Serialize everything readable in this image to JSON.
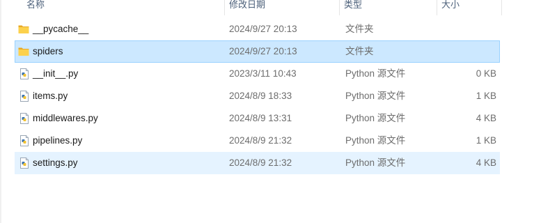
{
  "columns": {
    "name": "名称",
    "date": "修改日期",
    "type": "类型",
    "size": "大小"
  },
  "files": [
    {
      "name": "__pycache__",
      "date": "2024/9/27 20:13",
      "type": "文件夹",
      "size": "",
      "icon": "folder-icon",
      "state": "normal"
    },
    {
      "name": "spiders",
      "date": "2024/9/27 20:13",
      "type": "文件夹",
      "size": "",
      "icon": "folder-icon",
      "state": "selected"
    },
    {
      "name": "__init__.py",
      "date": "2023/3/11 10:43",
      "type": "Python 源文件",
      "size": "0 KB",
      "icon": "python-file-icon",
      "state": "normal"
    },
    {
      "name": "items.py",
      "date": "2024/8/9 18:33",
      "type": "Python 源文件",
      "size": "1 KB",
      "icon": "python-file-icon",
      "state": "normal"
    },
    {
      "name": "middlewares.py",
      "date": "2024/8/9 13:31",
      "type": "Python 源文件",
      "size": "4 KB",
      "icon": "python-file-icon",
      "state": "normal"
    },
    {
      "name": "pipelines.py",
      "date": "2024/8/9 21:32",
      "type": "Python 源文件",
      "size": "1 KB",
      "icon": "python-file-icon",
      "state": "normal"
    },
    {
      "name": "settings.py",
      "date": "2024/8/9 21:32",
      "type": "Python 源文件",
      "size": "4 KB",
      "icon": "python-file-icon",
      "state": "hover"
    }
  ],
  "colors": {
    "selected_bg": "#cce8ff",
    "selected_border": "#99d1ff",
    "hover_bg": "#e5f3ff",
    "folder": "#f8c740"
  }
}
